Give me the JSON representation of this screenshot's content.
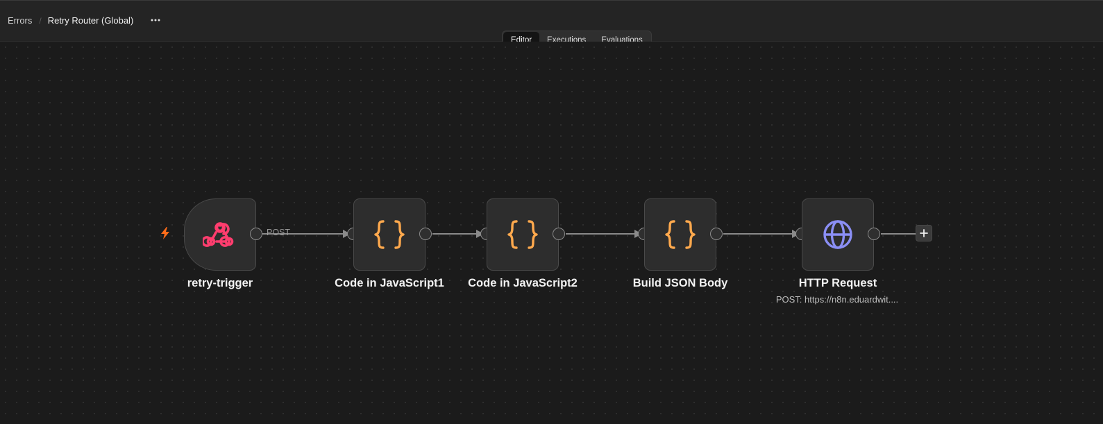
{
  "header": {
    "breadcrumb_parent": "Errors",
    "breadcrumb_separator": "/",
    "workflow_name": "Retry Router (Global)",
    "more_label": "···"
  },
  "tabs": [
    {
      "label": "Editor",
      "active": true
    },
    {
      "label": "Executions",
      "active": false
    },
    {
      "label": "Evaluations",
      "active": false
    }
  ],
  "nodes": [
    {
      "label": "retry-trigger",
      "icon": "webhook-icon",
      "icon_color": "#ff3d6e"
    },
    {
      "label": "Code in JavaScript1",
      "icon": "code-braces-icon",
      "icon_color": "#ffa94d"
    },
    {
      "label": "Code in JavaScript2",
      "icon": "code-braces-icon",
      "icon_color": "#ffa94d"
    },
    {
      "label": "Build JSON Body",
      "icon": "code-braces-icon",
      "icon_color": "#ffa94d"
    },
    {
      "label": "HTTP Request",
      "subtitle": "POST: https://n8n.eduardwit....",
      "icon": "globe-icon",
      "icon_color": "#8b8ff5"
    }
  ],
  "edges": [
    {
      "from": "retry-trigger",
      "to": "Code in JavaScript1",
      "label": "POST"
    },
    {
      "from": "Code in JavaScript1",
      "to": "Code in JavaScript2",
      "label": ""
    },
    {
      "from": "Code in JavaScript2",
      "to": "Build JSON Body",
      "label": ""
    },
    {
      "from": "Build JSON Body",
      "to": "HTTP Request",
      "label": ""
    }
  ],
  "trigger_icon": "lightning-bolt-icon",
  "trigger_icon_color": "#ff6d1a",
  "add_node_icon": "plus-icon"
}
